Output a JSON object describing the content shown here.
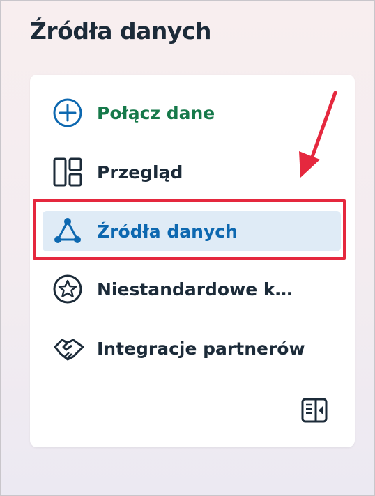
{
  "header": {
    "title": "Źródła danych"
  },
  "nav": {
    "items": [
      {
        "label": "Połącz dane",
        "icon": "plus-circle-icon",
        "color": "#16794a"
      },
      {
        "label": "Przegląd",
        "icon": "layout-icon"
      },
      {
        "label": "Źródła danych",
        "icon": "network-icon",
        "active": true,
        "color": "#0d68b0"
      },
      {
        "label": "Niestandardowe k…",
        "icon": "star-circle-icon"
      },
      {
        "label": "Integracje partnerów",
        "icon": "handshake-icon"
      }
    ],
    "collapse_icon": "collapse-panel-icon"
  },
  "annotation": {
    "highlight_color": "#e5283e",
    "arrow_color": "#e5283e"
  },
  "colors": {
    "primary_text": "#1c2b39",
    "active_bg": "#dfebf6"
  }
}
